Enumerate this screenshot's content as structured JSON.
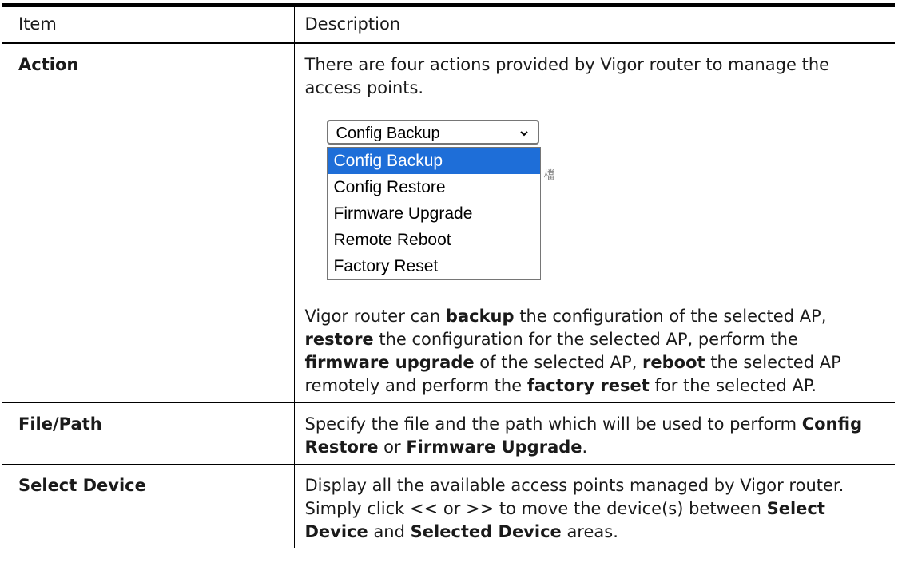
{
  "header": {
    "item": "Item",
    "description": "Description"
  },
  "rows": [
    {
      "item": "Action",
      "intro": "There are four actions provided by Vigor router to manage the access points.",
      "dropdown": {
        "selected": "Config Backup",
        "options": [
          "Config Backup",
          "Config Restore",
          "Firmware Upgrade",
          "Remote Reboot",
          "Factory Reset"
        ],
        "stray_glyph": "檔"
      },
      "desc_parts": [
        "Vigor router can ",
        "backup",
        " the configuration of the selected AP, ",
        "restore",
        " the configuration for the selected AP, perform the ",
        "firmware upgrade",
        " of the selected AP, ",
        "reboot",
        " the selected AP remotely and perform the ",
        "factory reset",
        " for the selected AP."
      ]
    },
    {
      "item": "File/Path",
      "desc_parts": [
        "Specify the file and the path which will be used to perform ",
        "Config Restore",
        " or ",
        "Firmware Upgrade",
        "."
      ]
    },
    {
      "item": "Select Device",
      "desc_parts": [
        "Display all the available access points managed by Vigor router. Simply click << or >> to move the device(s) between ",
        "Select Device",
        " and ",
        "Selected Device",
        " areas."
      ]
    }
  ]
}
